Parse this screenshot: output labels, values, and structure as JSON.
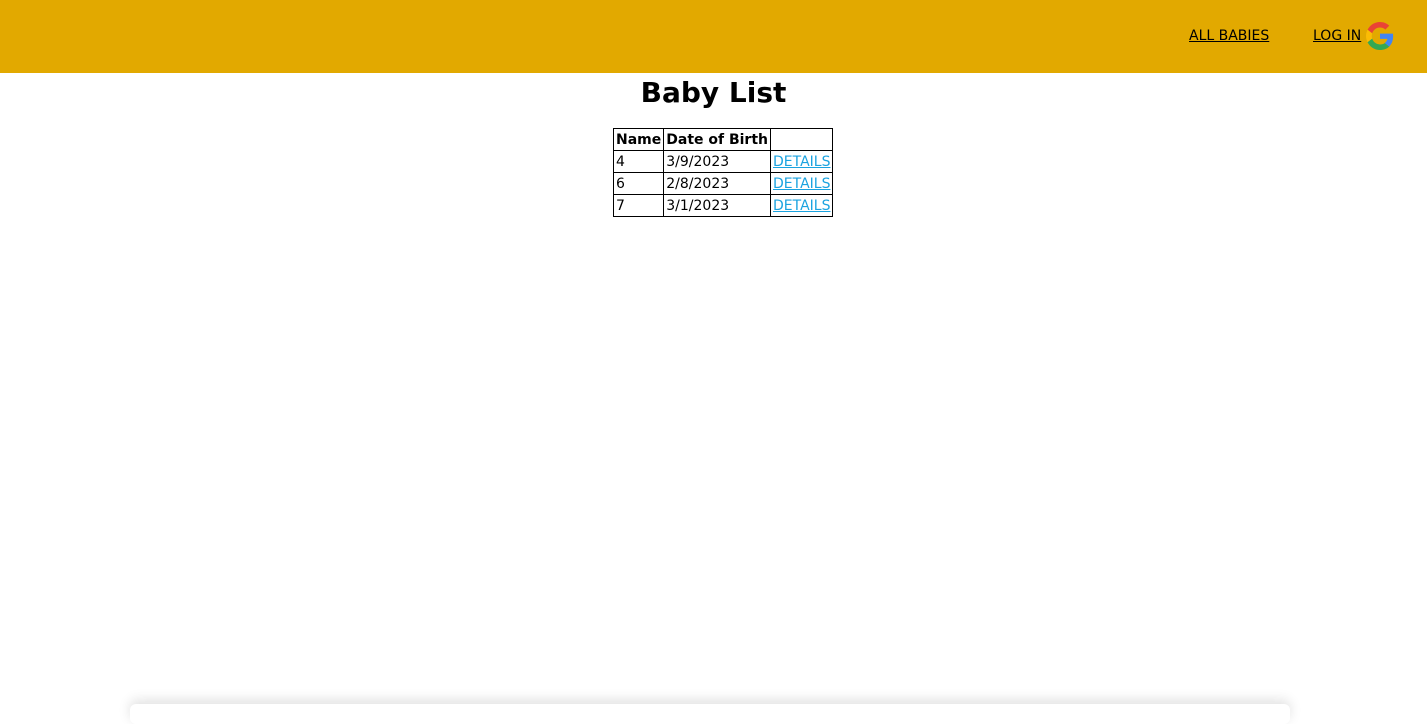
{
  "header": {
    "background_color": "#e2a900",
    "nav": {
      "all_babies_label": "ALL BABIES",
      "login_label": "LOG IN"
    },
    "login_icon": "google-icon"
  },
  "main": {
    "title": "Baby List",
    "table": {
      "columns": [
        "Name",
        "Date of Birth",
        ""
      ],
      "rows": [
        {
          "name": "4",
          "dob": "3/9/2023",
          "link": "DETAILS"
        },
        {
          "name": "6",
          "dob": "2/8/2023",
          "link": "DETAILS"
        },
        {
          "name": "7",
          "dob": "3/1/2023",
          "link": "DETAILS"
        }
      ]
    },
    "link_color": "#1aa3e0"
  }
}
